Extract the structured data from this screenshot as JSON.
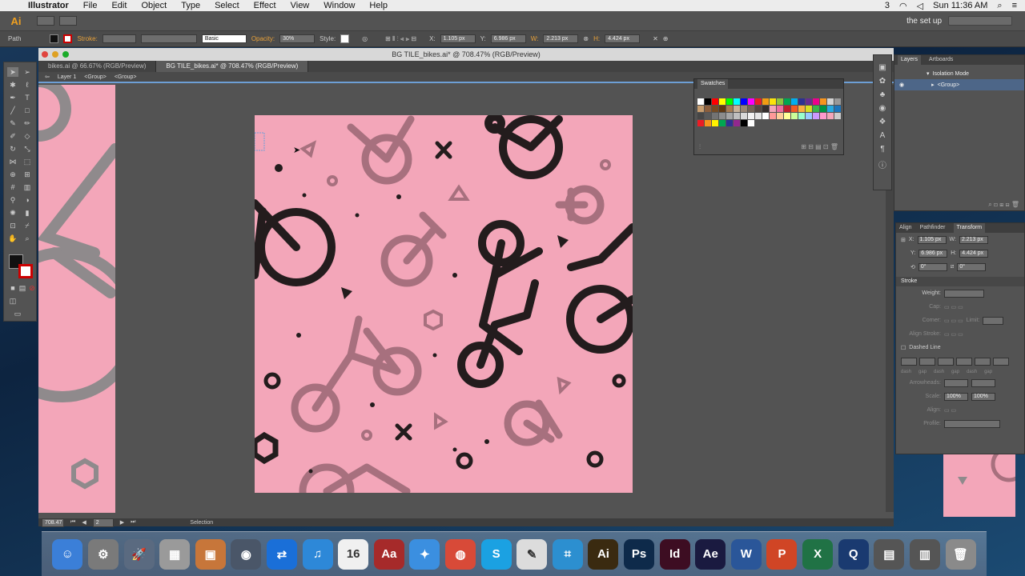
{
  "menubar": {
    "app_name": "Illustrator",
    "items": [
      "File",
      "Edit",
      "Object",
      "Type",
      "Select",
      "Effect",
      "View",
      "Window",
      "Help"
    ],
    "status_items": [
      "3",
      "Sun 11:36 AM"
    ]
  },
  "apptoolbar": {
    "logo": "Ai",
    "workspace": "the set up"
  },
  "controlbar": {
    "selection_type": "Path",
    "stroke_label": "Stroke:",
    "brush": "Basic",
    "opacity_label": "Opacity:",
    "opacity_value": "30%",
    "style_label": "Style:",
    "x_label": "X:",
    "x_value": "1.105 px",
    "y_label": "Y:",
    "y_value": "6.986 px",
    "w_label": "W:",
    "w_value": "2.213 px",
    "h_label": "H:",
    "h_value": "4.424 px"
  },
  "document": {
    "title": "BG TILE_bikes.ai* @ 708.47% (RGB/Preview)",
    "tabs": [
      "bikes.ai @ 66.67% (RGB/Preview)",
      "BG TILE_bikes.ai* @ 708.47% (RGB/Preview)"
    ],
    "breadcrumb": [
      "Layer 1",
      "<Group>",
      "<Group>"
    ],
    "zoom": "708.47",
    "page": "2",
    "status": "Selection"
  },
  "layers_panel": {
    "tabs": [
      "Layers",
      "Artboards"
    ],
    "rows": [
      "Isolation Mode",
      "<Group>"
    ]
  },
  "swatches_panel": {
    "title": "Swatches",
    "colors": [
      "#ffffff",
      "#000000",
      "#ff0000",
      "#ffff00",
      "#00ff00",
      "#00ffff",
      "#0000ff",
      "#ff00ff",
      "#e81e25",
      "#f39c12",
      "#fbe30c",
      "#8cc63e",
      "#00a651",
      "#00aeef",
      "#2e3192",
      "#662d91",
      "#ec008c",
      "#f7941d",
      "#d4d4d4",
      "#999999",
      "#c69c6d",
      "#8b5e3c",
      "#754c24",
      "#603913",
      "#a67c52",
      "#c7b299",
      "#998675",
      "#736357",
      "#534741",
      "#362f2d",
      "#f3a6b9",
      "#ed6ea0",
      "#be1e2d",
      "#f15a24",
      "#fbb040",
      "#d7df23",
      "#39b54a",
      "#009444",
      "#27aae1",
      "#1c75bc",
      "#464646",
      "#595959",
      "#737373",
      "#8c8c8c",
      "#a6a6a6",
      "#bfbfbf",
      "#d9d9d9",
      "#f2f2f2",
      "#e6e6e6",
      "#ffffff",
      "#ff9999",
      "#ffcc99",
      "#ffff99",
      "#ccff99",
      "#99ffcc",
      "#99ccff",
      "#cc99ff",
      "#ff99cc",
      "#f3a6b9",
      "#cccccc",
      "#ed1c24",
      "#f7941d",
      "#fff200",
      "#00a651",
      "#2e3192",
      "#92278f",
      "#000000",
      "#ffffff"
    ]
  },
  "transform_panel": {
    "tabs": [
      "Align",
      "Pathfinder",
      "Transform"
    ],
    "x": "1.105 px",
    "y": "6.986 px",
    "w": "2.213 px",
    "h": "4.424 px",
    "angle": "0°",
    "shear": "0°"
  },
  "stroke_panel": {
    "title": "Stroke",
    "weight_label": "Weight:",
    "cap_label": "Cap:",
    "corner_label": "Corner:",
    "limit_label": "Limit:",
    "align_label": "Align Stroke:",
    "dashed_label": "Dashed Line",
    "dash_labels": [
      "dash",
      "gap",
      "dash",
      "gap",
      "dash",
      "gap"
    ],
    "arrowheads_label": "Arrowheads:",
    "scale_label": "Scale:",
    "scale_value": "100%",
    "align2_label": "Align:",
    "profile_label": "Profile:"
  },
  "dock": {
    "apps": [
      {
        "name": "Finder",
        "glyph": "☺",
        "color": "#3b7fd8"
      },
      {
        "name": "System Preferences",
        "glyph": "⚙",
        "color": "#7a7a7a"
      },
      {
        "name": "Launchpad",
        "glyph": "🚀",
        "color": "#5a6a80"
      },
      {
        "name": "Calculator",
        "glyph": "▦",
        "color": "#9a9a9a"
      },
      {
        "name": "iPhoto",
        "glyph": "▣",
        "color": "#c7763a"
      },
      {
        "name": "Camera",
        "glyph": "◉",
        "color": "#4a5668"
      },
      {
        "name": "TeamViewer",
        "glyph": "⇄",
        "color": "#1a6fd8"
      },
      {
        "name": "iTunes",
        "glyph": "♫",
        "color": "#2d88d8"
      },
      {
        "name": "Calendar",
        "glyph": "16",
        "color": "#f0f0f0"
      },
      {
        "name": "Dictionary",
        "glyph": "Aa",
        "color": "#a62a2a"
      },
      {
        "name": "Safari",
        "glyph": "✦",
        "color": "#3b8fe0"
      },
      {
        "name": "Chrome",
        "glyph": "◍",
        "color": "#d84a38"
      },
      {
        "name": "Skype",
        "glyph": "S",
        "color": "#1ba1e2"
      },
      {
        "name": "TextEdit",
        "glyph": "✎",
        "color": "#dcdcdc"
      },
      {
        "name": "Screenshot",
        "glyph": "⌗",
        "color": "#2c8fd0"
      },
      {
        "name": "Illustrator",
        "glyph": "Ai",
        "color": "#3a2a10"
      },
      {
        "name": "Photoshop",
        "glyph": "Ps",
        "color": "#0e2a4a"
      },
      {
        "name": "InDesign",
        "glyph": "Id",
        "color": "#3d0d22"
      },
      {
        "name": "After Effects",
        "glyph": "Ae",
        "color": "#1a1a40"
      },
      {
        "name": "Word",
        "glyph": "W",
        "color": "#2a5699"
      },
      {
        "name": "PowerPoint",
        "glyph": "P",
        "color": "#d04525"
      },
      {
        "name": "Excel",
        "glyph": "X",
        "color": "#207245"
      },
      {
        "name": "QuickTime",
        "glyph": "Q",
        "color": "#1a3a70"
      },
      {
        "name": "Downloads",
        "glyph": "▤",
        "color": "#555555"
      },
      {
        "name": "Documents",
        "glyph": "▥",
        "color": "#555555"
      },
      {
        "name": "Trash",
        "glyph": "🗑",
        "color": "#8a8a8a"
      }
    ]
  }
}
